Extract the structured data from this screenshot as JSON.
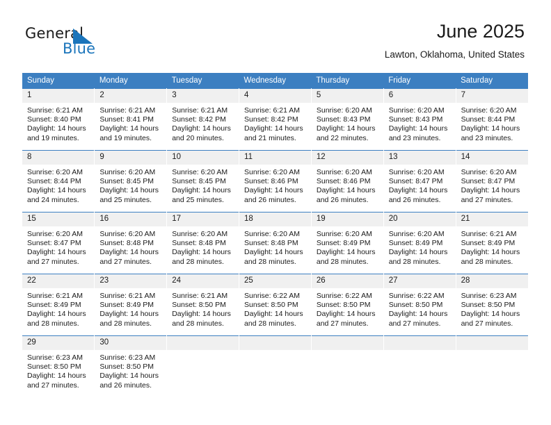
{
  "logo": {
    "word_general": "General",
    "word_blue": "Blue",
    "mark": "triangle-flag-icon",
    "color_blue": "#1b75bb",
    "color_dark": "#1a1a1a"
  },
  "header": {
    "title": "June 2025",
    "subtitle": "Lawton, Oklahoma, United States"
  },
  "theme": {
    "header_row_bg": "#3c7fc1",
    "daynum_bg": "#f0f0f0",
    "cell_bg": "#ffffff",
    "text": "#1a1a1a"
  },
  "weekdays": [
    "Sunday",
    "Monday",
    "Tuesday",
    "Wednesday",
    "Thursday",
    "Friday",
    "Saturday"
  ],
  "labels": {
    "sunrise_prefix": "Sunrise:",
    "sunset_prefix": "Sunset:",
    "daylight_prefix": "Daylight:"
  },
  "weeks": [
    [
      {
        "day": "1",
        "sunrise": "Sunrise: 6:21 AM",
        "sunset": "Sunset: 8:40 PM",
        "daylight1": "Daylight: 14 hours",
        "daylight2": "and 19 minutes."
      },
      {
        "day": "2",
        "sunrise": "Sunrise: 6:21 AM",
        "sunset": "Sunset: 8:41 PM",
        "daylight1": "Daylight: 14 hours",
        "daylight2": "and 19 minutes."
      },
      {
        "day": "3",
        "sunrise": "Sunrise: 6:21 AM",
        "sunset": "Sunset: 8:42 PM",
        "daylight1": "Daylight: 14 hours",
        "daylight2": "and 20 minutes."
      },
      {
        "day": "4",
        "sunrise": "Sunrise: 6:21 AM",
        "sunset": "Sunset: 8:42 PM",
        "daylight1": "Daylight: 14 hours",
        "daylight2": "and 21 minutes."
      },
      {
        "day": "5",
        "sunrise": "Sunrise: 6:20 AM",
        "sunset": "Sunset: 8:43 PM",
        "daylight1": "Daylight: 14 hours",
        "daylight2": "and 22 minutes."
      },
      {
        "day": "6",
        "sunrise": "Sunrise: 6:20 AM",
        "sunset": "Sunset: 8:43 PM",
        "daylight1": "Daylight: 14 hours",
        "daylight2": "and 23 minutes."
      },
      {
        "day": "7",
        "sunrise": "Sunrise: 6:20 AM",
        "sunset": "Sunset: 8:44 PM",
        "daylight1": "Daylight: 14 hours",
        "daylight2": "and 23 minutes."
      }
    ],
    [
      {
        "day": "8",
        "sunrise": "Sunrise: 6:20 AM",
        "sunset": "Sunset: 8:44 PM",
        "daylight1": "Daylight: 14 hours",
        "daylight2": "and 24 minutes."
      },
      {
        "day": "9",
        "sunrise": "Sunrise: 6:20 AM",
        "sunset": "Sunset: 8:45 PM",
        "daylight1": "Daylight: 14 hours",
        "daylight2": "and 25 minutes."
      },
      {
        "day": "10",
        "sunrise": "Sunrise: 6:20 AM",
        "sunset": "Sunset: 8:45 PM",
        "daylight1": "Daylight: 14 hours",
        "daylight2": "and 25 minutes."
      },
      {
        "day": "11",
        "sunrise": "Sunrise: 6:20 AM",
        "sunset": "Sunset: 8:46 PM",
        "daylight1": "Daylight: 14 hours",
        "daylight2": "and 26 minutes."
      },
      {
        "day": "12",
        "sunrise": "Sunrise: 6:20 AM",
        "sunset": "Sunset: 8:46 PM",
        "daylight1": "Daylight: 14 hours",
        "daylight2": "and 26 minutes."
      },
      {
        "day": "13",
        "sunrise": "Sunrise: 6:20 AM",
        "sunset": "Sunset: 8:47 PM",
        "daylight1": "Daylight: 14 hours",
        "daylight2": "and 26 minutes."
      },
      {
        "day": "14",
        "sunrise": "Sunrise: 6:20 AM",
        "sunset": "Sunset: 8:47 PM",
        "daylight1": "Daylight: 14 hours",
        "daylight2": "and 27 minutes."
      }
    ],
    [
      {
        "day": "15",
        "sunrise": "Sunrise: 6:20 AM",
        "sunset": "Sunset: 8:47 PM",
        "daylight1": "Daylight: 14 hours",
        "daylight2": "and 27 minutes."
      },
      {
        "day": "16",
        "sunrise": "Sunrise: 6:20 AM",
        "sunset": "Sunset: 8:48 PM",
        "daylight1": "Daylight: 14 hours",
        "daylight2": "and 27 minutes."
      },
      {
        "day": "17",
        "sunrise": "Sunrise: 6:20 AM",
        "sunset": "Sunset: 8:48 PM",
        "daylight1": "Daylight: 14 hours",
        "daylight2": "and 28 minutes."
      },
      {
        "day": "18",
        "sunrise": "Sunrise: 6:20 AM",
        "sunset": "Sunset: 8:48 PM",
        "daylight1": "Daylight: 14 hours",
        "daylight2": "and 28 minutes."
      },
      {
        "day": "19",
        "sunrise": "Sunrise: 6:20 AM",
        "sunset": "Sunset: 8:49 PM",
        "daylight1": "Daylight: 14 hours",
        "daylight2": "and 28 minutes."
      },
      {
        "day": "20",
        "sunrise": "Sunrise: 6:20 AM",
        "sunset": "Sunset: 8:49 PM",
        "daylight1": "Daylight: 14 hours",
        "daylight2": "and 28 minutes."
      },
      {
        "day": "21",
        "sunrise": "Sunrise: 6:21 AM",
        "sunset": "Sunset: 8:49 PM",
        "daylight1": "Daylight: 14 hours",
        "daylight2": "and 28 minutes."
      }
    ],
    [
      {
        "day": "22",
        "sunrise": "Sunrise: 6:21 AM",
        "sunset": "Sunset: 8:49 PM",
        "daylight1": "Daylight: 14 hours",
        "daylight2": "and 28 minutes."
      },
      {
        "day": "23",
        "sunrise": "Sunrise: 6:21 AM",
        "sunset": "Sunset: 8:49 PM",
        "daylight1": "Daylight: 14 hours",
        "daylight2": "and 28 minutes."
      },
      {
        "day": "24",
        "sunrise": "Sunrise: 6:21 AM",
        "sunset": "Sunset: 8:50 PM",
        "daylight1": "Daylight: 14 hours",
        "daylight2": "and 28 minutes."
      },
      {
        "day": "25",
        "sunrise": "Sunrise: 6:22 AM",
        "sunset": "Sunset: 8:50 PM",
        "daylight1": "Daylight: 14 hours",
        "daylight2": "and 28 minutes."
      },
      {
        "day": "26",
        "sunrise": "Sunrise: 6:22 AM",
        "sunset": "Sunset: 8:50 PM",
        "daylight1": "Daylight: 14 hours",
        "daylight2": "and 27 minutes."
      },
      {
        "day": "27",
        "sunrise": "Sunrise: 6:22 AM",
        "sunset": "Sunset: 8:50 PM",
        "daylight1": "Daylight: 14 hours",
        "daylight2": "and 27 minutes."
      },
      {
        "day": "28",
        "sunrise": "Sunrise: 6:23 AM",
        "sunset": "Sunset: 8:50 PM",
        "daylight1": "Daylight: 14 hours",
        "daylight2": "and 27 minutes."
      }
    ],
    [
      {
        "day": "29",
        "sunrise": "Sunrise: 6:23 AM",
        "sunset": "Sunset: 8:50 PM",
        "daylight1": "Daylight: 14 hours",
        "daylight2": "and 27 minutes."
      },
      {
        "day": "30",
        "sunrise": "Sunrise: 6:23 AM",
        "sunset": "Sunset: 8:50 PM",
        "daylight1": "Daylight: 14 hours",
        "daylight2": "and 26 minutes."
      },
      {
        "day": "",
        "sunrise": "",
        "sunset": "",
        "daylight1": "",
        "daylight2": ""
      },
      {
        "day": "",
        "sunrise": "",
        "sunset": "",
        "daylight1": "",
        "daylight2": ""
      },
      {
        "day": "",
        "sunrise": "",
        "sunset": "",
        "daylight1": "",
        "daylight2": ""
      },
      {
        "day": "",
        "sunrise": "",
        "sunset": "",
        "daylight1": "",
        "daylight2": ""
      },
      {
        "day": "",
        "sunrise": "",
        "sunset": "",
        "daylight1": "",
        "daylight2": ""
      }
    ]
  ]
}
